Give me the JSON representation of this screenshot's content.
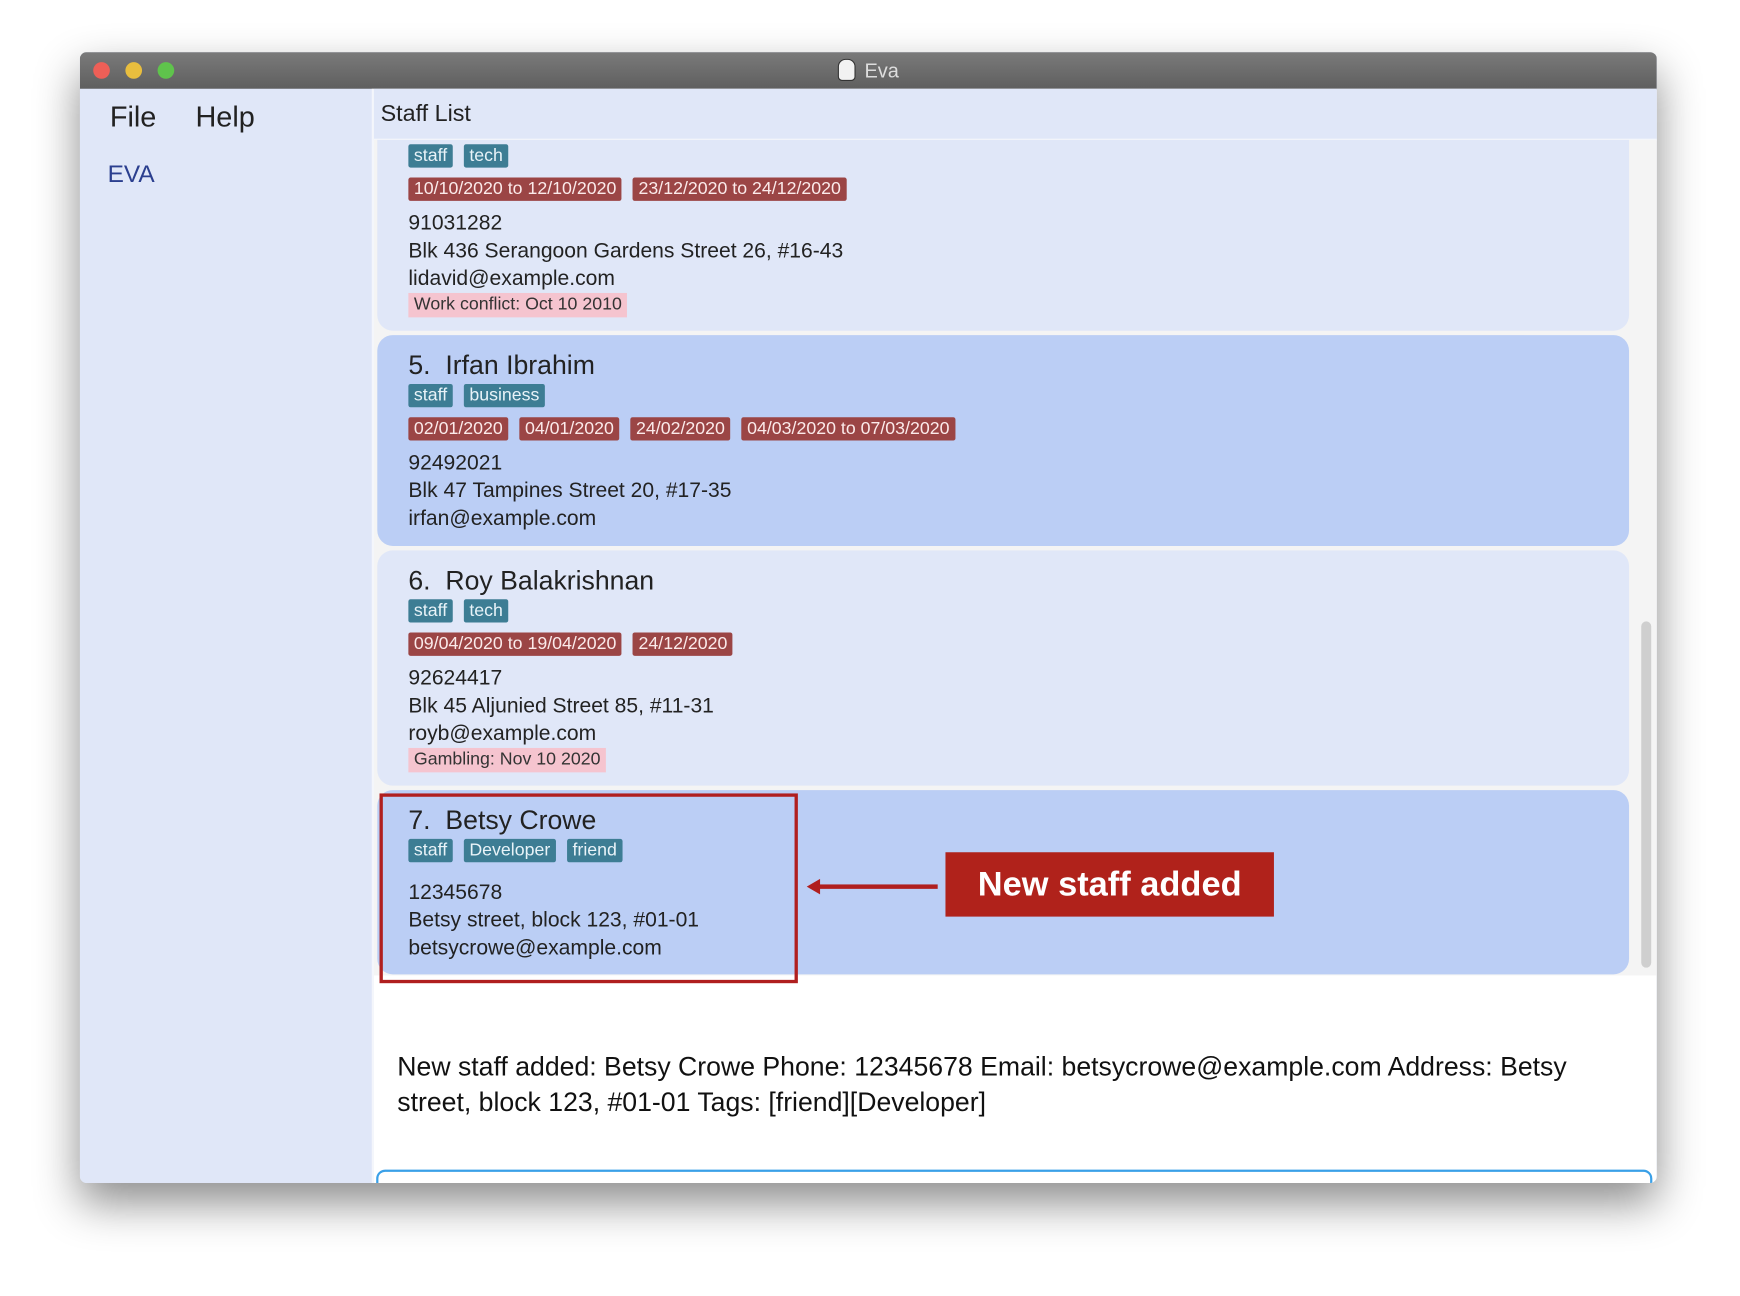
{
  "window": {
    "title": "Eva",
    "traffic_lights": [
      "#ee5f57",
      "#e9be3e",
      "#5fc34c"
    ]
  },
  "menu": {
    "file": "File",
    "help": "Help"
  },
  "sidebar": {
    "eva_label": "EVA"
  },
  "header": {
    "title": "Staff List"
  },
  "staff": [
    {
      "tags": [
        "staff",
        "tech"
      ],
      "dates": [
        "10/10/2020 to 12/10/2020",
        "23/12/2020 to 24/12/2020"
      ],
      "phone": "91031282",
      "address": "Blk 436 Serangoon Gardens Street 26, #16-43",
      "email": "lidavid@example.com",
      "remark": "Work conflict: Oct 10 2010"
    },
    {
      "index": "5.",
      "name": "Irfan Ibrahim",
      "tags": [
        "staff",
        "business"
      ],
      "dates": [
        "02/01/2020",
        "04/01/2020",
        "24/02/2020",
        "04/03/2020 to 07/03/2020"
      ],
      "phone": "92492021",
      "address": "Blk 47 Tampines Street 20, #17-35",
      "email": "irfan@example.com"
    },
    {
      "index": "6.",
      "name": "Roy Balakrishnan",
      "tags": [
        "staff",
        "tech"
      ],
      "dates": [
        "09/04/2020 to 19/04/2020",
        "24/12/2020"
      ],
      "phone": "92624417",
      "address": "Blk 45 Aljunied Street 85, #11-31",
      "email": "royb@example.com",
      "remark": "Gambling: Nov 10 2020"
    },
    {
      "index": "7.",
      "name": "Betsy Crowe",
      "tags": [
        "staff",
        "Developer",
        "friend"
      ],
      "phone": "12345678",
      "address": "Betsy street, block 123, #01-01",
      "email": "betsycrowe@example.com"
    }
  ],
  "result": {
    "text": "New staff added: Betsy Crowe Phone: 12345678 Email: betsycrowe@example.com Address: Betsy street, block 123, #01-01 Tags: [friend][Developer]"
  },
  "command": {
    "value": ""
  },
  "annotation": {
    "label": "New staff added",
    "color": "#b0221b"
  }
}
